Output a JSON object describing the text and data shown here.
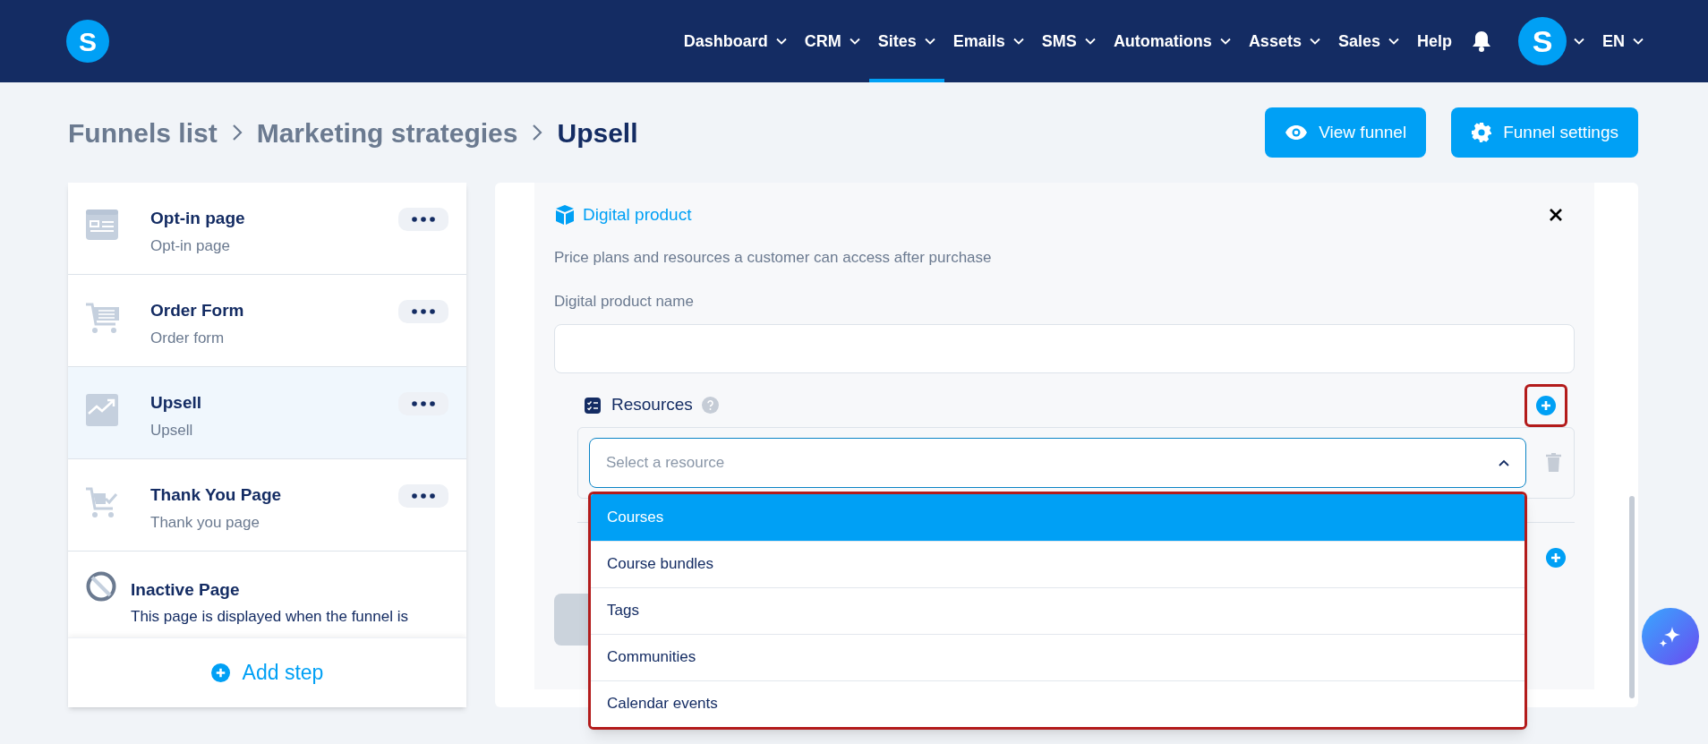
{
  "nav": {
    "logo": "S",
    "avatar": "S",
    "language": "EN",
    "items": [
      {
        "label": "Dashboard",
        "selected": false,
        "dropdown": true
      },
      {
        "label": "CRM",
        "selected": false,
        "dropdown": true
      },
      {
        "label": "Sites",
        "selected": true,
        "dropdown": true
      },
      {
        "label": "Emails",
        "selected": false,
        "dropdown": true
      },
      {
        "label": "SMS",
        "selected": false,
        "dropdown": true
      },
      {
        "label": "Automations",
        "selected": false,
        "dropdown": true
      },
      {
        "label": "Assets",
        "selected": false,
        "dropdown": true
      },
      {
        "label": "Sales",
        "selected": false,
        "dropdown": true
      },
      {
        "label": "Help",
        "selected": false,
        "dropdown": false
      }
    ]
  },
  "breadcrumb": [
    "Funnels list",
    "Marketing strategies",
    "Upsell"
  ],
  "actions": [
    {
      "label": "View funnel",
      "kind": "view"
    },
    {
      "label": "Funnel settings",
      "kind": "settings"
    }
  ],
  "steps": [
    {
      "title": "Opt-in page",
      "subtitle": "Opt-in page",
      "kind": "optin",
      "selected": false
    },
    {
      "title": "Order Form",
      "subtitle": "Order form",
      "kind": "order",
      "selected": false
    },
    {
      "title": "Upsell",
      "subtitle": "Upsell",
      "kind": "upsell",
      "selected": true
    },
    {
      "title": "Thank You Page",
      "subtitle": "Thank you page",
      "kind": "thankyou",
      "selected": false
    }
  ],
  "inactive_page": {
    "title": "Inactive Page",
    "description": "This page is displayed when the funnel is"
  },
  "add_step": "Add step",
  "digital_product": {
    "title": "Digital product",
    "description": "Price plans and resources a customer can access after purchase",
    "name_label": "Digital product name",
    "resources_label": "Resources",
    "add_highlighted": true,
    "select": {
      "placeholder": "Select a resource",
      "expanded": true,
      "highlighted": true,
      "options": [
        {
          "label": "Courses",
          "selected": true
        },
        {
          "label": "Course bundles",
          "selected": false
        },
        {
          "label": "Tags",
          "selected": false
        },
        {
          "label": "Communities",
          "selected": false
        },
        {
          "label": "Calendar events",
          "selected": false
        }
      ]
    }
  }
}
